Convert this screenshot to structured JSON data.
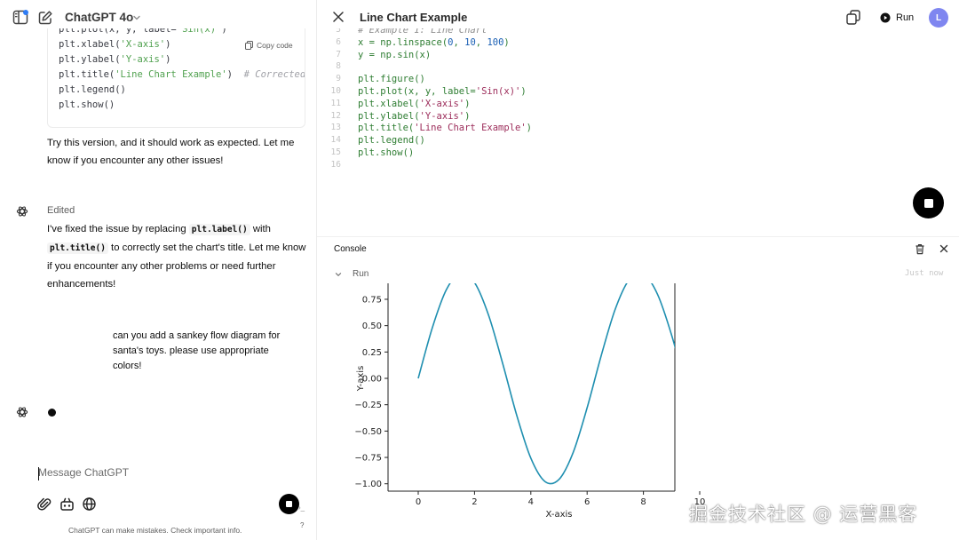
{
  "chat": {
    "model_name": "ChatGPT 4o",
    "code_block": {
      "copy_label": "Copy code",
      "lines": [
        [
          {
            "t": "plt.plot(x, y, label="
          },
          {
            "t": "'Sin(x)'",
            "k": "str"
          },
          {
            "t": ")"
          }
        ],
        [
          {
            "t": "plt.xlabel("
          },
          {
            "t": "'X-axis'",
            "k": "str"
          },
          {
            "t": ")"
          }
        ],
        [
          {
            "t": "plt.ylabel("
          },
          {
            "t": "'Y-axis'",
            "k": "str"
          },
          {
            "t": ")"
          }
        ],
        [
          {
            "t": "plt.title("
          },
          {
            "t": "'Line Chart Example'",
            "k": "str"
          },
          {
            "t": ")  "
          },
          {
            "t": "# Corrected f",
            "k": "com"
          }
        ],
        [
          {
            "t": "plt.legend()"
          }
        ],
        [
          {
            "t": "plt.show()"
          }
        ]
      ]
    },
    "msg_try": "Try this version, and it should work as expected. Let me know if you encounter any other issues!",
    "edited_label": "Edited",
    "msg_fixed_part1": "I've fixed the issue by replacing ",
    "msg_fixed_code1": "plt.label()",
    "msg_fixed_part2": " with ",
    "msg_fixed_code2": "plt.title()",
    "msg_fixed_part3": " to correctly set the chart's title. Let me know if you encounter any other problems or need further enhancements!",
    "user_message": "can you add a sankey flow diagram for santa's toys. please use appropriate colors!",
    "composer_placeholder": "Message ChatGPT",
    "disclaimer": "ChatGPT can make mistakes. Check important info.",
    "help": "?"
  },
  "canvas": {
    "title": "Line Chart Example",
    "run_label": "Run",
    "user_initial": "L",
    "editor_lines": [
      {
        "n": "5",
        "tokens": [
          {
            "t": "# Example 1: Line Chart",
            "k": "com"
          }
        ]
      },
      {
        "n": "6",
        "tokens": [
          {
            "t": "x = np.linspace(",
            "k": "grn"
          },
          {
            "t": "0",
            "k": "num"
          },
          {
            "t": ", ",
            "k": "grn"
          },
          {
            "t": "10",
            "k": "num"
          },
          {
            "t": ", ",
            "k": "grn"
          },
          {
            "t": "100",
            "k": "num"
          },
          {
            "t": ")",
            "k": "grn"
          }
        ]
      },
      {
        "n": "7",
        "tokens": [
          {
            "t": "y = np.sin(x)",
            "k": "grn"
          }
        ]
      },
      {
        "n": "8",
        "tokens": []
      },
      {
        "n": "9",
        "tokens": [
          {
            "t": "plt.figure()",
            "k": "grn"
          }
        ]
      },
      {
        "n": "10",
        "tokens": [
          {
            "t": "plt.plot(x, y, label=",
            "k": "grn"
          },
          {
            "t": "'Sin(x)'",
            "k": "str"
          },
          {
            "t": ")",
            "k": "grn"
          }
        ]
      },
      {
        "n": "11",
        "tokens": [
          {
            "t": "plt.xlabel(",
            "k": "grn"
          },
          {
            "t": "'X-axis'",
            "k": "str"
          },
          {
            "t": ")",
            "k": "grn"
          }
        ]
      },
      {
        "n": "12",
        "tokens": [
          {
            "t": "plt.ylabel(",
            "k": "grn"
          },
          {
            "t": "'Y-axis'",
            "k": "str"
          },
          {
            "t": ")",
            "k": "grn"
          }
        ]
      },
      {
        "n": "13",
        "tokens": [
          {
            "t": "plt.title(",
            "k": "grn"
          },
          {
            "t": "'Line Chart Example'",
            "k": "str"
          },
          {
            "t": ")",
            "k": "grn"
          }
        ]
      },
      {
        "n": "14",
        "tokens": [
          {
            "t": "plt.legend()",
            "k": "grn"
          }
        ]
      },
      {
        "n": "15",
        "tokens": [
          {
            "t": "plt.show()",
            "k": "grn"
          }
        ]
      },
      {
        "n": "16",
        "tokens": []
      }
    ],
    "console": {
      "title": "Console",
      "run_row_label": "Run",
      "run_time": "Just now"
    }
  },
  "chart_data": {
    "type": "line",
    "xlabel": "X-axis",
    "ylabel": "Y-axis",
    "xlim": [
      0,
      10
    ],
    "x_ticks": [
      0,
      2,
      4,
      6,
      8,
      10
    ],
    "y_ticks": [
      -1.0,
      -0.75,
      -0.5,
      -0.25,
      0.0,
      0.25,
      0.5,
      0.75
    ],
    "y_tick_labels": [
      "−1.00",
      "−0.75",
      "−0.50",
      "−0.25",
      "0.00",
      "0.25",
      "0.50",
      "0.75"
    ],
    "series": [
      {
        "color": "#1f8fb0",
        "x": [
          0,
          0.5,
          1.0,
          1.5,
          2.0,
          2.5,
          3.0,
          3.5,
          4.0,
          4.5,
          5.0,
          5.5,
          6.0,
          6.5,
          7.0,
          7.5,
          8.0,
          8.5,
          9.0,
          9.5,
          10.0
        ],
        "y": [
          0.0,
          0.479,
          0.841,
          0.997,
          0.909,
          0.598,
          0.141,
          -0.351,
          -0.757,
          -0.978,
          -0.959,
          -0.706,
          -0.279,
          0.215,
          0.657,
          0.938,
          0.989,
          0.798,
          0.412,
          -0.075,
          -0.544
        ]
      }
    ]
  },
  "watermark": "掘金技术社区 @ 运营黑客",
  "colors": {
    "accent_avatar": "#7f86f0",
    "notification": "#2f7df6",
    "line": "#1f8fb0"
  }
}
